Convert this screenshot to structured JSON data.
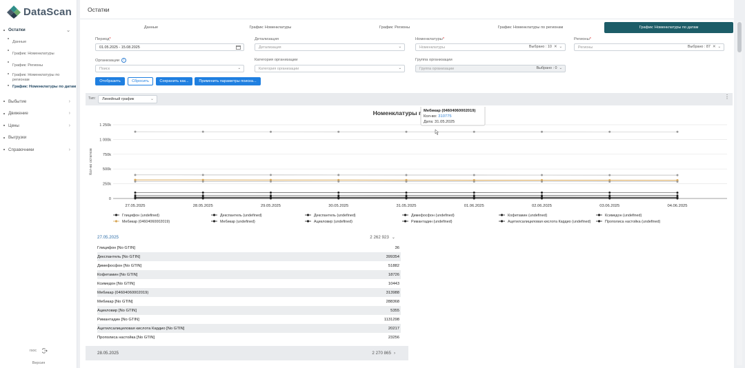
{
  "app": {
    "brand": "DataScan"
  },
  "sidebar": {
    "items": [
      {
        "label": "Остатки",
        "active": true
      },
      {
        "label": "Выбытие"
      },
      {
        "label": "Движение"
      },
      {
        "label": "Цены"
      },
      {
        "label": "Выгрузки"
      },
      {
        "label": "Справочники"
      }
    ],
    "subitems": [
      {
        "label": "Данные"
      },
      {
        "label": "График: Номенклатуры"
      },
      {
        "label": "График: Регионы"
      },
      {
        "label": "График: Номенклатуры по регионам"
      },
      {
        "label": "График: Номенклатуры по датам",
        "active": true
      }
    ],
    "footer": {
      "user": "rsoc",
      "version": "Версия"
    }
  },
  "page": {
    "title": "Остатки"
  },
  "tabs": [
    {
      "label": "Данные"
    },
    {
      "label": "График: Номенклатуры"
    },
    {
      "label": "График: Регионы"
    },
    {
      "label": "График: Номенклатуры по регионам"
    },
    {
      "label": "График: Номенклатуры по датам",
      "active": true
    }
  ],
  "filters": {
    "period": {
      "label": "Период",
      "value": "01.05.2025 - 15.08.2025"
    },
    "detail": {
      "label": "Детализация",
      "placeholder": "Детализация"
    },
    "nomenclature": {
      "label": "Номенклатуры",
      "placeholder": "Номенклатуры",
      "selected": "Выбрано : 10"
    },
    "regions": {
      "label": "Регионы",
      "placeholder": "Регионы",
      "selected": "Выбрано : 87"
    },
    "organization": {
      "label": "Организации",
      "placeholder": "Поиск"
    },
    "org_category": {
      "label": "Категория организации",
      "placeholder": "Категория организации"
    },
    "org_group": {
      "label": "Группа организации",
      "placeholder": "Группа организации",
      "selected": "Выбрано : 0"
    }
  },
  "buttons": {
    "show": "Отобразить",
    "reset": "Сбросить",
    "save_as": "Сохранить как...",
    "apply_search": "Применить параметры поиска..."
  },
  "chart_type": {
    "label": "Тип:",
    "value": "Линейный график"
  },
  "tooltip": {
    "title": "Мебикар (04604060002019)",
    "qty_label": "Кол-во:",
    "qty_value": "310775",
    "date_label": "Дата:",
    "date_value": "31.05.2025"
  },
  "colors": {
    "accent": "#1d5d68",
    "button": "#1f7fe0",
    "highlight": "#d7a657"
  },
  "chart_data": {
    "type": "line",
    "title": "Номенклатуры по датам",
    "ylabel": "Кол-во остатков",
    "xlabel": "",
    "ylim": [
      0,
      1250000
    ],
    "yticks": [
      0,
      250000,
      500000,
      750000,
      1000000,
      1250000
    ],
    "ytick_labels": [
      "0",
      "250k",
      "500k",
      "750k",
      "1 000k",
      "1 250k"
    ],
    "grid": true,
    "legend_placement": "bottom",
    "categories": [
      "27.05.2025",
      "28.05.2025",
      "29.05.2025",
      "30.05.2025",
      "31.05.2025",
      "01.06.2025",
      "02.06.2025",
      "03.06.2025",
      "04.06.2025"
    ],
    "series": [
      {
        "name": "Глицифон (undefined)",
        "values": [
          36,
          36,
          36,
          36,
          36,
          36,
          36,
          36,
          36
        ]
      },
      {
        "name": "Декспантель (undefined)",
        "values": [
          399354,
          399000,
          398500,
          398000,
          397500,
          397000,
          396500,
          396000,
          395500
        ]
      },
      {
        "name": "Декспантель (undefined)",
        "values": [
          51882,
          51800,
          51700,
          51600,
          51500,
          51400,
          51300,
          51200,
          51100
        ]
      },
      {
        "name": "Димефосфон (undefined)",
        "values": [
          18726,
          18700,
          18650,
          18600,
          18550,
          18500,
          18450,
          18400,
          18350
        ]
      },
      {
        "name": "Кофетамин (undefined)",
        "values": [
          10443,
          10400,
          10350,
          10300,
          10250,
          10200,
          10150,
          10100,
          10050
        ]
      },
      {
        "name": "Ксимедон (undefined)",
        "values": [
          5355,
          5350,
          5340,
          5330,
          5320,
          5310,
          5300,
          5290,
          5280
        ]
      },
      {
        "name": "Мебикар (04604060002019)",
        "values": [
          313988,
          313500,
          313000,
          312000,
          310775,
          310000,
          309500,
          309000,
          308500
        ]
      },
      {
        "name": "Мебикар (undefined)",
        "values": [
          288368,
          288000,
          287500,
          287000,
          286500,
          286000,
          285500,
          285000,
          284500
        ]
      },
      {
        "name": "Ацикловир (undefined)",
        "values": [
          1131298,
          1131000,
          1130800,
          1130600,
          1130400,
          1130200,
          1130000,
          1129800,
          1129600
        ]
      },
      {
        "name": "Римантадин (undefined)",
        "values": [
          20217,
          20200,
          20180,
          20160,
          20140,
          20120,
          20100,
          20080,
          20060
        ]
      },
      {
        "name": "Ацетилсалициловая кислота Кардио (undefined)",
        "values": [
          23256,
          23200,
          23150,
          23100,
          23050,
          23000,
          22950,
          22900,
          22850
        ]
      },
      {
        "name": "Прополиса настойка (undefined)",
        "values": [
          100000,
          99800,
          99600,
          99400,
          99200,
          99000,
          98800,
          98600,
          98400
        ]
      }
    ]
  },
  "legend": [
    {
      "name": "Глицифон (undefined)",
      "color": "#222"
    },
    {
      "name": "Декспантель (undefined)",
      "color": "#222"
    },
    {
      "name": "Декспантель (undefined)",
      "color": "#222"
    },
    {
      "name": "Димефосфон (undefined)",
      "color": "#222"
    },
    {
      "name": "Кофетамин (undefined)",
      "color": "#222"
    },
    {
      "name": "Ксимедон (undefined)",
      "color": "#222"
    },
    {
      "name": "Мебикар (04604060002019)",
      "color": "#d7a657"
    },
    {
      "name": "Мебикар (undefined)",
      "color": "#222"
    },
    {
      "name": "Ацикловир (undefined)",
      "color": "#222"
    },
    {
      "name": "Римантадин (undefined)",
      "color": "#222"
    },
    {
      "name": "Ацетилсалициловая кислота Кардио (undefined)",
      "color": "#222"
    },
    {
      "name": "Прополиса настойка (undefined)",
      "color": "#222"
    }
  ],
  "table": {
    "groups": [
      {
        "date": "27.05.2025",
        "total": "2 262 923",
        "rows": [
          {
            "name": "Глицифон [No GTIN]",
            "value": "36"
          },
          {
            "name": "Декспантель [No GTIN]",
            "value": "399354"
          },
          {
            "name": "Димефосфон [No GTIN]",
            "value": "51882"
          },
          {
            "name": "Кофетамин [No GTIN]",
            "value": "18726"
          },
          {
            "name": "Ксимедон [No GTIN]",
            "value": "10443"
          },
          {
            "name": "Мебикар (04604060002019)",
            "value": "313988"
          },
          {
            "name": "Мебикар [No GTIN]",
            "value": "288368"
          },
          {
            "name": "Ацикловир [No GTIN]",
            "value": "5355"
          },
          {
            "name": "Римантадин [No GTIN]",
            "value": "1131298"
          },
          {
            "name": "Ацетилсалициловая кислота Кардио [No GTIN]",
            "value": "20217"
          },
          {
            "name": "Прополиса настойка [No GTIN]",
            "value": "23256"
          }
        ]
      },
      {
        "date": "28.05.2025",
        "total": "2 270 865"
      }
    ]
  }
}
